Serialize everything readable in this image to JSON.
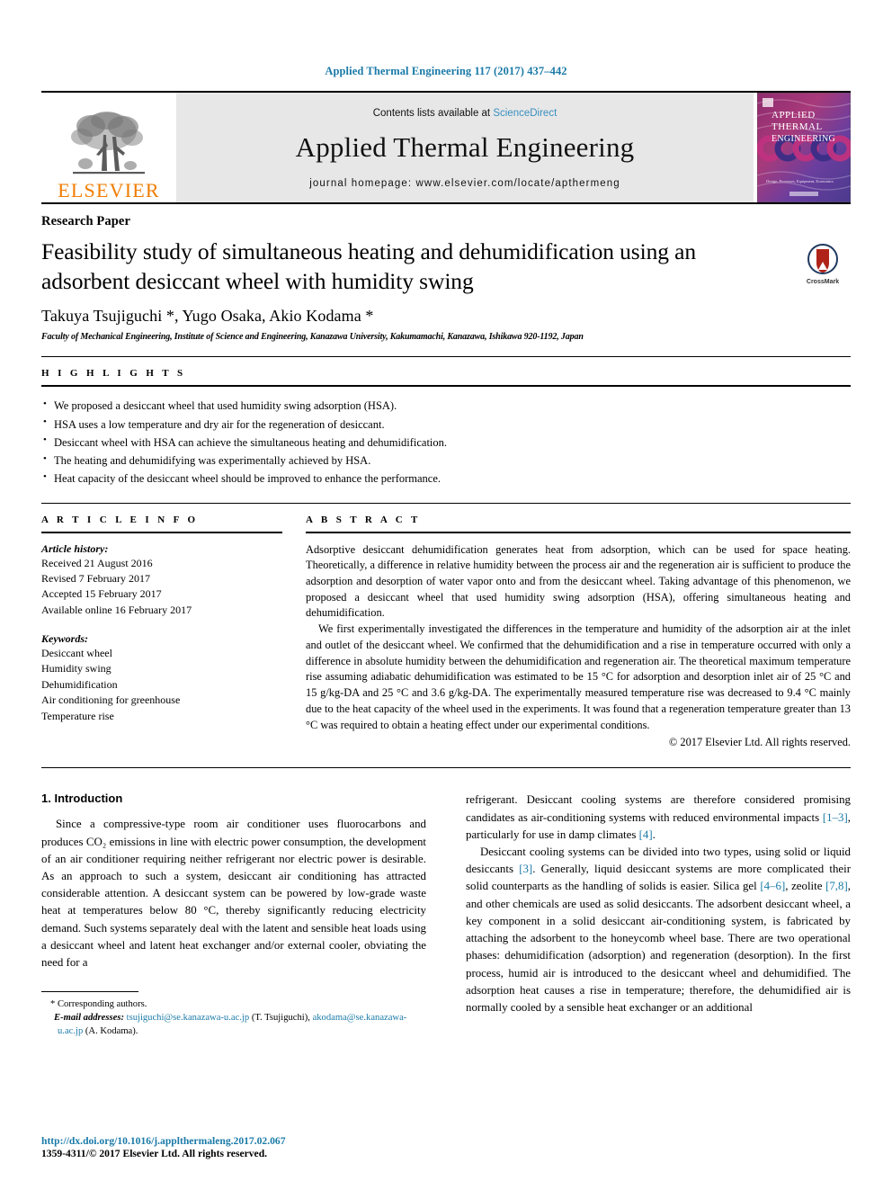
{
  "running_head": "Applied Thermal Engineering 117 (2017) 437–442",
  "masthead": {
    "publisher": "ELSEVIER",
    "publisher_logo": "elsevier-tree-logo",
    "contents_prefix": "Contents lists available at ",
    "contents_link": "ScienceDirect",
    "journal_title": "Applied Thermal Engineering",
    "homepage": "journal homepage: www.elsevier.com/locate/apthermeng",
    "cover": {
      "line1": "APPLIED",
      "line2": "THERMAL",
      "line3": "ENGINEERING",
      "footer": "Design, Processes, Equipment, Economics"
    }
  },
  "article": {
    "type": "Research Paper",
    "title": "Feasibility study of simultaneous heating and dehumidification using an adsorbent desiccant wheel with humidity swing",
    "authors": "Takuya Tsujiguchi *, Yugo Osaka, Akio Kodama *",
    "affiliation": "Faculty of Mechanical Engineering, Institute of Science and Engineering, Kanazawa University, Kakumamachi, Kanazawa, Ishikawa 920-1192, Japan",
    "crossmark_label": "CrossMark"
  },
  "highlights": {
    "heading": "H I G H L I G H T S",
    "items": [
      "We proposed a desiccant wheel that used humidity swing adsorption (HSA).",
      "HSA uses a low temperature and dry air for the regeneration of desiccant.",
      "Desiccant wheel with HSA can achieve the simultaneous heating and dehumidification.",
      "The heating and dehumidifying was experimentally achieved by HSA.",
      "Heat capacity of the desiccant wheel should be improved to enhance the performance."
    ]
  },
  "article_info": {
    "heading": "A R T I C L E    I N F O",
    "history_label": "Article history:",
    "history": [
      "Received 21 August 2016",
      "Revised 7 February 2017",
      "Accepted 15 February 2017",
      "Available online 16 February 2017"
    ],
    "keywords_label": "Keywords:",
    "keywords": [
      "Desiccant wheel",
      "Humidity swing",
      "Dehumidification",
      "Air conditioning for greenhouse",
      "Temperature rise"
    ]
  },
  "abstract": {
    "heading": "A B S T R A C T",
    "paragraphs": [
      "Adsorptive desiccant dehumidification generates heat from adsorption, which can be used for space heating. Theoretically, a difference in relative humidity between the process air and the regeneration air is sufficient to produce the adsorption and desorption of water vapor onto and from the desiccant wheel. Taking advantage of this phenomenon, we proposed a desiccant wheel that used humidity swing adsorption (HSA), offering simultaneous heating and dehumidification.",
      "We first experimentally investigated the differences in the temperature and humidity of the adsorption air at the inlet and outlet of the desiccant wheel. We confirmed that the dehumidification and a rise in temperature occurred with only a difference in absolute humidity between the dehumidification and regeneration air. The theoretical maximum temperature rise assuming adiabatic dehumidification was estimated to be 15 °C for adsorption and desorption inlet air of 25 °C and 15 g/kg-DA and 25 °C and 3.6 g/kg-DA. The experimentally measured temperature rise was decreased to 9.4 °C mainly due to the heat capacity of the wheel used in the experiments. It was found that a regeneration temperature greater than 13 °C was required to obtain a heating effect under our experimental conditions."
    ],
    "copyright": "© 2017 Elsevier Ltd. All rights reserved."
  },
  "body": {
    "section_title": "1. Introduction",
    "left_paragraph": "Since a compressive-type room air conditioner uses fluorocarbons and produces CO₂ emissions in line with electric power consumption, the development of an air conditioner requiring neither refrigerant nor electric power is desirable. As an approach to such a system, desiccant air conditioning has attracted considerable attention. A desiccant system can be powered by low-grade waste heat at temperatures below 80 °C, thereby significantly reducing electricity demand. Such systems separately deal with the latent and sensible heat loads using a desiccant wheel and latent heat exchanger and/or external cooler, obviating the need for a",
    "right_paragraph_1_a": "refrigerant. Desiccant cooling systems are therefore considered promising candidates as air-conditioning systems with reduced environmental impacts ",
    "right_cite_1": "[1–3]",
    "right_paragraph_1_b": ", particularly for use in damp climates ",
    "right_cite_2": "[4]",
    "right_paragraph_1_c": ".",
    "right_paragraph_2_a": "Desiccant cooling systems can be divided into two types, using solid or liquid desiccants ",
    "right_cite_3": "[3]",
    "right_paragraph_2_b": ". Generally, liquid desiccant systems are more complicated their solid counterparts as the handling of solids is easier. Silica gel ",
    "right_cite_4": "[4–6]",
    "right_paragraph_2_c": ", zeolite ",
    "right_cite_5": "[7,8]",
    "right_paragraph_2_d": ", and other chemicals are used as solid desiccants. The adsorbent desiccant wheel, a key component in a solid desiccant air-conditioning system, is fabricated by attaching the adsorbent to the honeycomb wheel base. There are two operational phases: dehumidification (adsorption) and regeneration (desorption). In the first process, humid air is introduced to the desiccant wheel and dehumidified. The adsorption heat causes a rise in temperature; therefore, the dehumidified air is normally cooled by a sensible heat exchanger or an additional"
  },
  "footnote": {
    "corresponding": "* Corresponding authors.",
    "email_label": "E-mail addresses:",
    "email_1": "tsujiguchi@se.kanazawa-u.ac.jp",
    "email_1_owner": " (T. Tsujiguchi), ",
    "email_2": "akodama@se.kanazawa-u.ac.jp",
    "email_2_owner": " (A. Kodama)."
  },
  "bottom": {
    "doi": "http://dx.doi.org/10.1016/j.applthermaleng.2017.02.067",
    "issn": "1359-4311/© 2017 Elsevier Ltd. All rights reserved."
  },
  "colors": {
    "link_blue": "#1a7aa8",
    "sciencedirect_blue": "#3a8fbf",
    "elsevier_orange": "#f07c00",
    "masthead_grey": "#e7e7e7"
  }
}
